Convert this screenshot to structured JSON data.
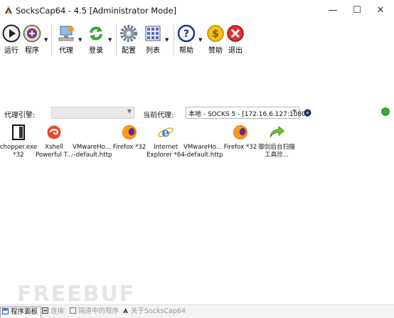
{
  "window": {
    "title": "SocksCap64 - 4.5 [Administrator Mode]",
    "controls": [
      "—",
      "☐",
      "✕"
    ]
  },
  "toolbar": {
    "run": "运行",
    "program": "程序",
    "proxy": "代理",
    "login": "登录",
    "config": "配置",
    "list": "列表",
    "help": "帮助",
    "donate": "赞助",
    "exit": "退出"
  },
  "proxy_bar": {
    "engine_label": "代理引擎:",
    "engine_value": "",
    "current_label": "当前代理:",
    "current_value": "本地 - SOCKS 5 - [172.16.6.127:1080]"
  },
  "programs": [
    {
      "label": "chopper.exe *32",
      "icon": "chopper-icon"
    },
    {
      "label": "Xshell Powerful T...",
      "icon": "xshell-icon"
    },
    {
      "label": "VMwareHo... --default.http",
      "icon": "vmware-icon"
    },
    {
      "label": "Firefox *32",
      "icon": "firefox-icon"
    },
    {
      "label": "Internet Explorer *64",
      "icon": "ie-icon"
    },
    {
      "label": "VMwareHo... --default.http",
      "icon": "vmware-icon"
    },
    {
      "label": "Firefox *32",
      "icon": "firefox-icon"
    },
    {
      "label": "御剑后台扫描工具珍...",
      "icon": "green-arrow-icon"
    }
  ],
  "status_tabs": {
    "program_panel": "程序面板",
    "connections": "连接",
    "running_programs": "隔道中的程序",
    "about": "关于SocksCap64"
  },
  "watermark": "FREEBUF",
  "colors": {
    "status_ok": "#2db52d",
    "accent_blue": "#1a4fa0"
  }
}
